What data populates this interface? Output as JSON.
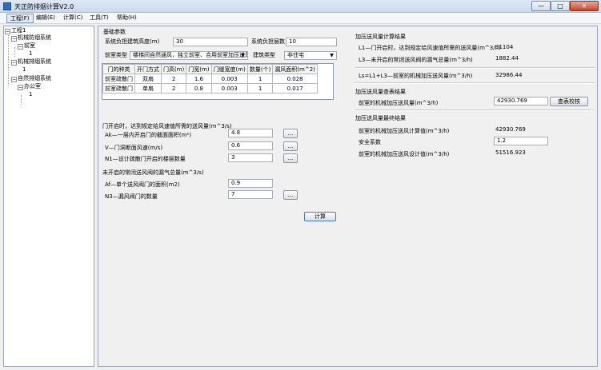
{
  "window": {
    "title": "天正防排烟计算V2.0",
    "btn_min": "—",
    "btn_max": "□",
    "btn_close": "✕"
  },
  "menu": [
    "工程(F)",
    "编辑(E)",
    "计算(C)",
    "工具(T)",
    "帮助(H)"
  ],
  "tree": [
    {
      "label": "工程1",
      "box": "−"
    },
    {
      "label": "机械防烟系统",
      "box": "−"
    },
    {
      "label": "前室",
      "box": "−"
    },
    {
      "label": "1",
      "box": ""
    },
    {
      "label": "机械排烟系统",
      "box": "−"
    },
    {
      "label": "1",
      "box": ""
    },
    {
      "label": "自然排烟系统",
      "box": "−"
    },
    {
      "label": "办公室",
      "box": "−"
    },
    {
      "label": "1",
      "box": ""
    }
  ],
  "basic": {
    "section": "基础参数",
    "height_label": "系统负担建筑高度(m)",
    "height_value": "30",
    "floors_label": "系统负担层数",
    "floors_value": "10",
    "room_type_label": "前室类型",
    "room_type_value": "楼梯间自然通风，独立前室、合用前室加压送风",
    "building_type_label": "建筑类型",
    "building_type_value": "非住宅"
  },
  "door_table": {
    "headers": [
      "门的种类",
      "开门方式",
      "门高(m)",
      "门宽(m)",
      "门缝宽度(m)",
      "数量(个)",
      "漏风面积(m^2)"
    ],
    "rows": [
      [
        "前室疏散门",
        "双扇",
        "2",
        "1.6",
        "0.003",
        "1",
        "0.028"
      ],
      [
        "前室疏散门",
        "单扇",
        "2",
        "0.8",
        "0.003",
        "1",
        "0.017"
      ]
    ]
  },
  "open_door": {
    "section": "门开启时，达到规定给风速值所需的送风量(m^3/s)",
    "ak_label": "Ak—一层内开启门的截面面积(m²)",
    "ak_value": "4.8",
    "v_label": "V—门洞断面风速(m/s)",
    "v_value": "0.6",
    "n1_label": "N1—设计疏散门开启的楼层数量",
    "n1_value": "3",
    "more": "..."
  },
  "closed_valve": {
    "section": "未开启的常闭送风阀的漏气总量(m^3/s)",
    "af_label": "Af—单个送风阀门的面积(m2)",
    "af_value": "0.9",
    "n3_label": "N3—漏风阀门的数量",
    "n3_value": "7",
    "more": "..."
  },
  "calc_button": "计算",
  "calc_results": {
    "section": "加压送风量计算结果",
    "l1_label": "L1—门开启时，达到规定给风速值所需的送风量(m^3/h)",
    "l1_value": "31104",
    "l3_label": "L3—未开启的常闭送风阀的漏气总量(m^3/h)",
    "l3_value": "1882.44",
    "ls_label": "Ls=L1+L3—前室的机械加压送风量(m^3/h)",
    "ls_value": "32986.44"
  },
  "table_results": {
    "section": "加压送风量查表结果",
    "label": "前室的机械加压送风量(m^3/h)",
    "value": "42930.769",
    "button": "查表校核"
  },
  "final_results": {
    "section": "加压送风量最终结果",
    "calc_label": "前室的机械加压送风计算值(m^3/h)",
    "calc_value": "42930.769",
    "safety_label": "安全系数",
    "safety_value": "1.2",
    "design_label": "前室的机械加压送风设计值(m^3/h)",
    "design_value": "51516.923"
  }
}
